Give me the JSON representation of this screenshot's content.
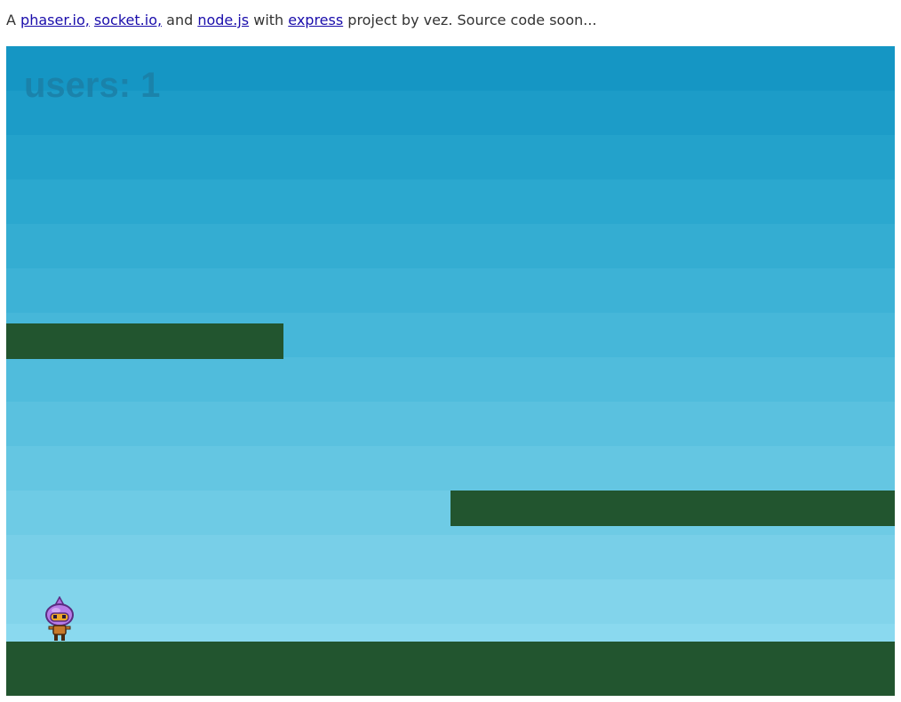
{
  "intro": {
    "prefix": "A ",
    "links": [
      "phaser.io,",
      "socket.io,",
      "node.js",
      "express"
    ],
    "sep1": " ",
    "sep2": " and ",
    "sep3": " with ",
    "suffix": " project by vez. Source code soon..."
  },
  "hud": {
    "users_label": "users: 1"
  },
  "colors": {
    "sky_top": "#1596c4",
    "sky_bottom": "#8ad9ef",
    "platform": "#22552f",
    "link": "#1a0dab",
    "hud_text": "#1b7fa6"
  },
  "icons": {
    "player": "onion-head-character-sprite"
  }
}
